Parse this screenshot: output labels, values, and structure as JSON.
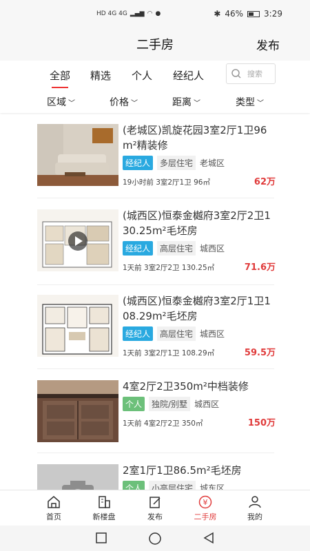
{
  "status": {
    "left_icons": "HD 4G 4G",
    "battery": "46%",
    "time": "3:29"
  },
  "header": {
    "title": "二手房",
    "publish": "发布"
  },
  "tabs": [
    {
      "label": "全部",
      "active": true
    },
    {
      "label": "精选"
    },
    {
      "label": "个人"
    },
    {
      "label": "经纪人"
    }
  ],
  "search": {
    "placeholder": "搜索"
  },
  "filters": [
    "区域",
    "价格",
    "距离",
    "类型"
  ],
  "listings": [
    {
      "title": "(老城区)凯旋花园3室2厅1卫96m²精装修",
      "tag": "经纪人",
      "tag_kind": "agent",
      "type": "多层住宅",
      "district": "老城区",
      "meta": "19小时前 3室2厅1卫 96㎡",
      "price": "62万"
    },
    {
      "title": "(城西区)恒泰金樾府3室2厅2卫130.25m²毛坯房",
      "tag": "经纪人",
      "tag_kind": "agent",
      "type": "高层住宅",
      "district": "城西区",
      "meta": "1天前 3室2厅2卫 130.25㎡",
      "price": "71.6万"
    },
    {
      "title": "(城西区)恒泰金樾府3室2厅1卫108.29m²毛坯房",
      "tag": "经纪人",
      "tag_kind": "agent",
      "type": "高层住宅",
      "district": "城西区",
      "meta": "1天前 3室2厅1卫 108.29㎡",
      "price": "59.5万"
    },
    {
      "title": "4室2厅2卫350m²中档装修",
      "tag": "个人",
      "tag_kind": "person",
      "type": "独院/别墅",
      "district": "城西区",
      "meta": "1天前 4室2厅2卫 350㎡",
      "price": "150万"
    },
    {
      "title": "2室1厅1卫86.5m²毛坯房",
      "tag": "个人",
      "tag_kind": "person",
      "type": "小高层住宅",
      "district": "城东区",
      "meta": "",
      "price": ""
    }
  ],
  "bottom_nav": [
    {
      "label": "首页",
      "icon": "home-icon"
    },
    {
      "label": "新楼盘",
      "icon": "building-icon"
    },
    {
      "label": "发布",
      "icon": "edit-icon"
    },
    {
      "label": "二手房",
      "icon": "yuan-icon",
      "active": true
    },
    {
      "label": "我的",
      "icon": "user-icon"
    }
  ],
  "colors": {
    "accent": "#e03b3b",
    "agent_tag": "#29a9e0",
    "person_tag": "#6cc07a"
  }
}
